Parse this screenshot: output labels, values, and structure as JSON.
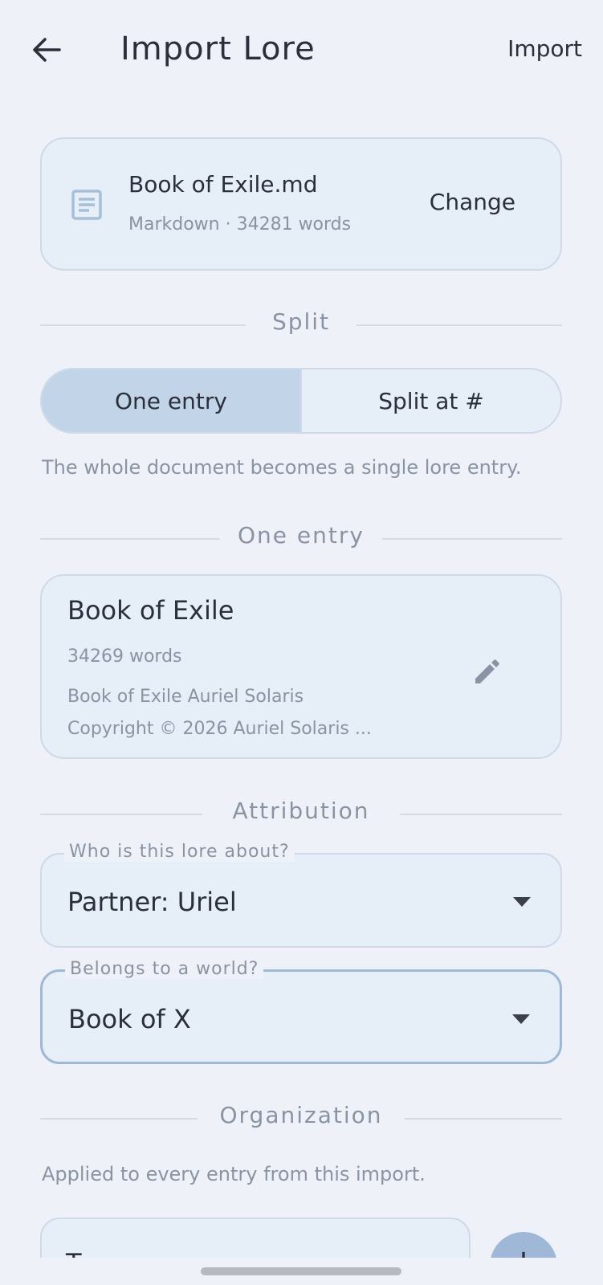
{
  "app_bar": {
    "title": "Import Lore",
    "import_action": "Import",
    "back_icon": "arrow-back-icon"
  },
  "file": {
    "icon": "document-icon",
    "name": "Book of Exile.md",
    "meta": "Markdown · 34281 words",
    "change_label": "Change"
  },
  "split_section": {
    "title": "Split",
    "options": [
      "One entry",
      "Split at #"
    ],
    "selected": "One entry",
    "hint": "The whole document becomes a single lore entry."
  },
  "entry_section": {
    "title": "One entry",
    "entry": {
      "title": "Book of Exile",
      "words": "34269 words",
      "preview_line1": "Book of Exile Auriel Solaris",
      "preview_line2": "Copyright © 2026 Auriel Solaris ...",
      "edit_icon": "pencil-icon"
    }
  },
  "attribution_section": {
    "title": "Attribution",
    "about_field": {
      "label": "Who is this lore about?",
      "value": "Partner: Uriel"
    },
    "world_field": {
      "label": "Belongs to a world?",
      "value": "Book of X"
    }
  },
  "organization_section": {
    "title": "Organization",
    "hint": "Applied to every entry from this import.",
    "tag_input_partial": "T",
    "add_icon": "plus-icon"
  },
  "colors": {
    "background": "#eef2f8",
    "card": "#e6eef8",
    "segment_active": "#c2d5e8",
    "fab": "#9fb8d8",
    "muted_text": "#8a93a3"
  }
}
